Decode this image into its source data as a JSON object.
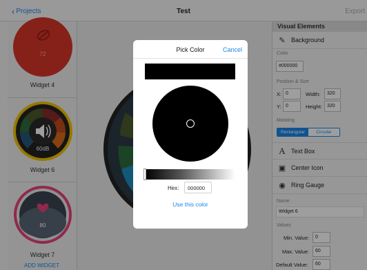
{
  "topbar": {
    "back_label": "Projects",
    "title": "Test",
    "export_label": "Export"
  },
  "sidebar": {
    "widgets": [
      {
        "label": "Widget 4",
        "value": "72"
      },
      {
        "label": "Widget 6",
        "value": "60dB"
      },
      {
        "label": "Widget 7",
        "value": "80"
      }
    ],
    "add_widget_label": "ADD WIDGET"
  },
  "panel": {
    "header": "Visual Elements",
    "background_label": "Background",
    "color_section": "Color",
    "color_value": "#000000",
    "position_section": "Position & Size",
    "x_label": "X:",
    "x_value": "0",
    "y_label": "Y:",
    "y_value": "0",
    "width_label": "Width:",
    "width_value": "320",
    "height_label": "Height:",
    "height_value": "320",
    "masking_section": "Masking",
    "mask_rect": "Rectangular",
    "mask_circ": "Circular",
    "textbox_label": "Text Box",
    "center_icon_label": "Center Icon",
    "ring_gauge_label": "Ring Gauge",
    "name_section": "Name",
    "name_value": "Widget 6",
    "values_section": "Values",
    "min_label": "Min. Value:",
    "min_value": "0",
    "max_label": "Max. Value:",
    "max_value": "60",
    "default_label": "Default Value:",
    "default_value": "60"
  },
  "modal": {
    "title": "Pick Color",
    "cancel_label": "Cancel",
    "current_color": "#000000",
    "brightness": 0,
    "hex_label": "Hex:",
    "hex_value": "000000",
    "use_label": "Use this color"
  },
  "colors": {
    "accent": "#1a86e8",
    "widget4": "#d8362a",
    "widget6_ring": "#f2c200",
    "widget7_ring": "#e8437d"
  }
}
